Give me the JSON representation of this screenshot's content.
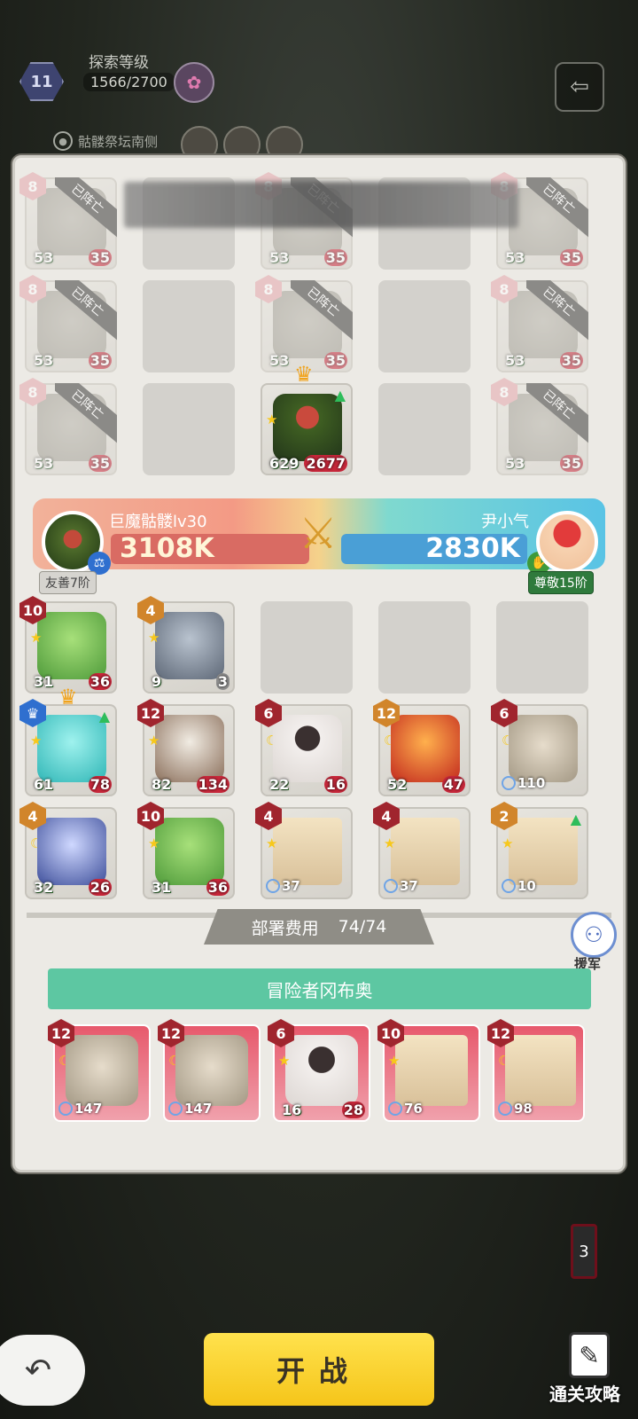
{
  "header": {
    "level": "11",
    "title": "探索等级",
    "progress": "1566/2700",
    "location": "骷髅祭坛南侧"
  },
  "enemy_grid": [
    [
      {
        "rank": "8",
        "atk": "53",
        "hp": "35",
        "dead": true,
        "tag": "已阵亡"
      },
      {
        "empty": true
      },
      {
        "rank": "8",
        "atk": "53",
        "hp": "35",
        "dead": true,
        "tag": "已阵亡"
      },
      {
        "empty": true
      },
      {
        "rank": "8",
        "atk": "53",
        "hp": "35",
        "dead": true,
        "tag": "已阵亡"
      }
    ],
    [
      {
        "rank": "8",
        "atk": "53",
        "hp": "35",
        "dead": true,
        "tag": "已阵亡"
      },
      {
        "empty": true
      },
      {
        "rank": "8",
        "atk": "53",
        "hp": "35",
        "dead": true,
        "tag": "已阵亡"
      },
      {
        "empty": true
      },
      {
        "rank": "8",
        "atk": "53",
        "hp": "35",
        "dead": true,
        "tag": "已阵亡"
      }
    ],
    [
      {
        "rank": "8",
        "atk": "53",
        "hp": "35",
        "dead": true,
        "tag": "已阵亡"
      },
      {
        "empty": true
      },
      {
        "atk": "629",
        "hp": "2677",
        "boss": true
      },
      {
        "empty": true
      },
      {
        "rank": "8",
        "atk": "53",
        "hp": "35",
        "dead": true,
        "tag": "已阵亡"
      }
    ]
  ],
  "versus": {
    "left_name": "巨魔骷髅lv30",
    "left_power": "3108K",
    "right_name": "尹小气",
    "right_power": "2830K",
    "left_tag": "友善7阶",
    "right_tag": "尊敬15阶"
  },
  "player_grid": [
    [
      {
        "rank": "10",
        "atk": "31",
        "hp": "36"
      },
      {
        "rank": "4",
        "atk": "9",
        "hp": "3"
      },
      {
        "empty": true
      },
      {
        "empty": true
      },
      {
        "empty": true
      }
    ],
    [
      {
        "atk": "61",
        "hp": "78"
      },
      {
        "rank": "12",
        "atk": "82",
        "hp": "134"
      },
      {
        "rank": "6",
        "atk": "22",
        "hp": "16"
      },
      {
        "rank": "12",
        "atk": "52",
        "hp": "47"
      },
      {
        "rank": "6",
        "mag": "110"
      }
    ],
    [
      {
        "rank": "4",
        "atk": "32",
        "hp": "26"
      },
      {
        "rank": "10",
        "atk": "31",
        "hp": "36"
      },
      {
        "rank": "4",
        "mag": "37"
      },
      {
        "rank": "4",
        "mag": "37"
      },
      {
        "rank": "2",
        "mag": "10"
      }
    ]
  ],
  "deploy": {
    "label": "部署费用",
    "value": "74/74"
  },
  "aid_label": "援军",
  "adventurer": "冒险者冈布奥",
  "hand": [
    {
      "rank": "12",
      "mag": "147"
    },
    {
      "rank": "12",
      "mag": "147"
    },
    {
      "rank": "6",
      "atk": "16",
      "hp": "28"
    },
    {
      "rank": "10",
      "mag": "76"
    },
    {
      "rank": "12",
      "mag": "98"
    }
  ],
  "battery": "3",
  "start_label": "开战",
  "guide_label": "通关攻略",
  "colors": {
    "start": "#f5c51a",
    "adventurer_bar": "#5dc7a2",
    "rank_red": "#a0252e",
    "rank_orange": "#d1852b"
  }
}
